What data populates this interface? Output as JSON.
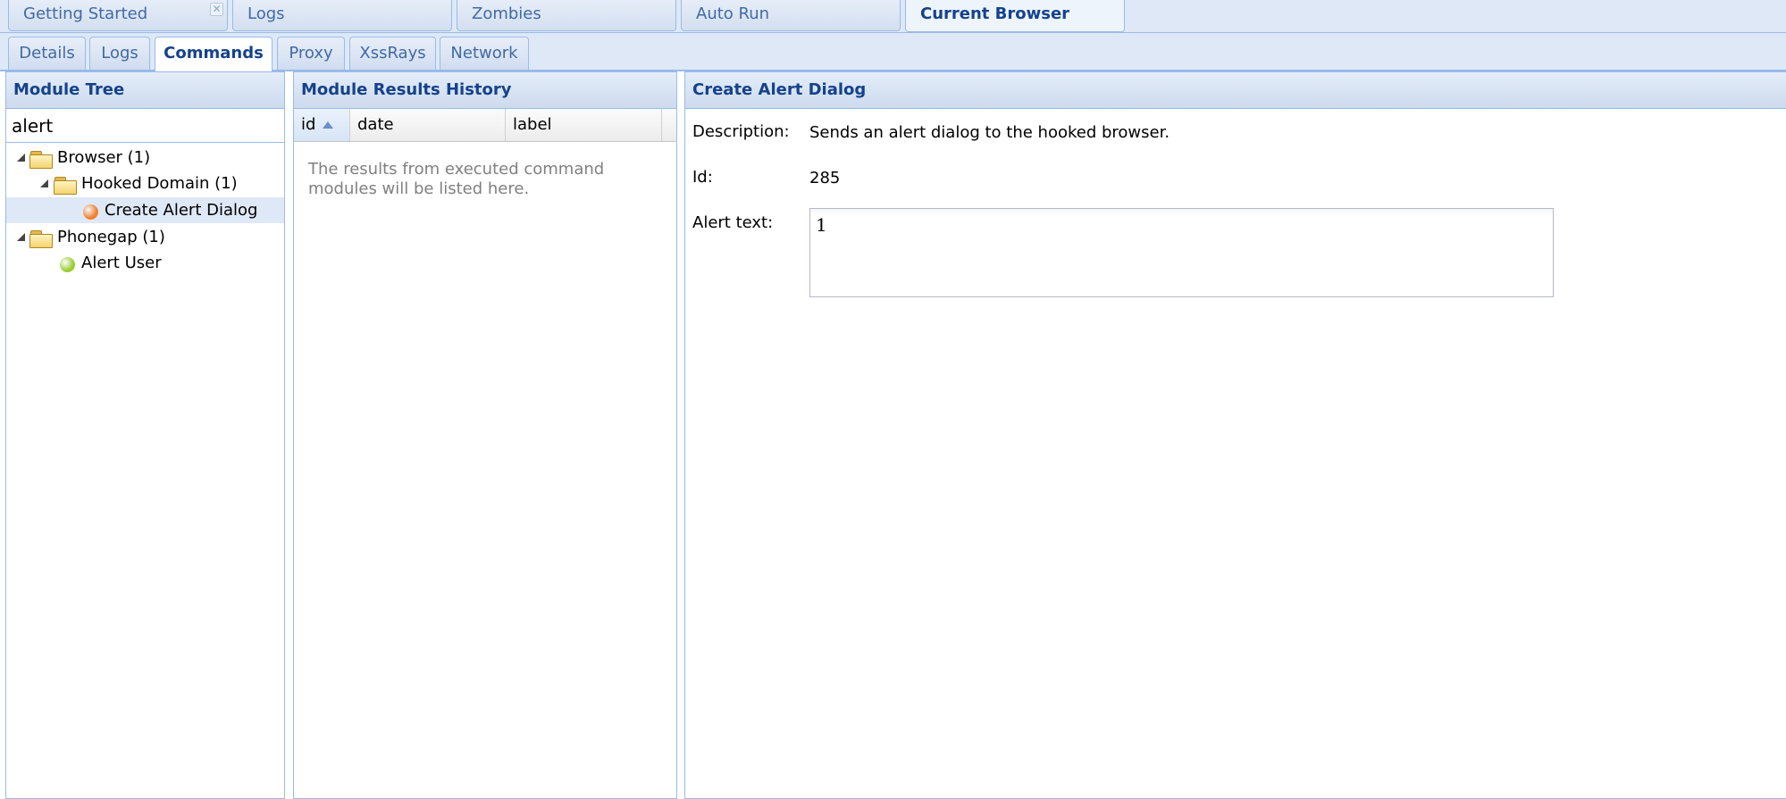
{
  "top_tabs": [
    {
      "label": "Getting Started",
      "closable": true
    },
    {
      "label": "Logs"
    },
    {
      "label": "Zombies"
    },
    {
      "label": "Auto Run"
    },
    {
      "label": "Current Browser",
      "active": true
    }
  ],
  "sub_tabs": [
    {
      "label": "Details"
    },
    {
      "label": "Logs"
    },
    {
      "label": "Commands",
      "active": true
    },
    {
      "label": "Proxy"
    },
    {
      "label": "XssRays"
    },
    {
      "label": "Network"
    }
  ],
  "module_tree": {
    "title": "Module Tree",
    "search_value": "alert",
    "nodes": [
      {
        "label": "Browser (1)",
        "type": "folder"
      },
      {
        "label": "Hooked Domain (1)",
        "type": "folder"
      },
      {
        "label": "Create Alert Dialog",
        "type": "module",
        "status_color": "#f0812f",
        "selected": true
      },
      {
        "label": "Phonegap (1)",
        "type": "folder"
      },
      {
        "label": "Alert User",
        "type": "module",
        "status_color": "#9acd32"
      }
    ]
  },
  "history": {
    "title": "Module Results History",
    "columns": [
      "id",
      "date",
      "label"
    ],
    "empty_message": "The results from executed command modules will be listed here."
  },
  "detail": {
    "title": "Create Alert Dialog",
    "description_label": "Description:",
    "description_value": "Sends an alert dialog to the hooked browser.",
    "id_label": "Id:",
    "id_value": "285",
    "alert_text_label": "Alert text:",
    "alert_text_value": "1"
  }
}
